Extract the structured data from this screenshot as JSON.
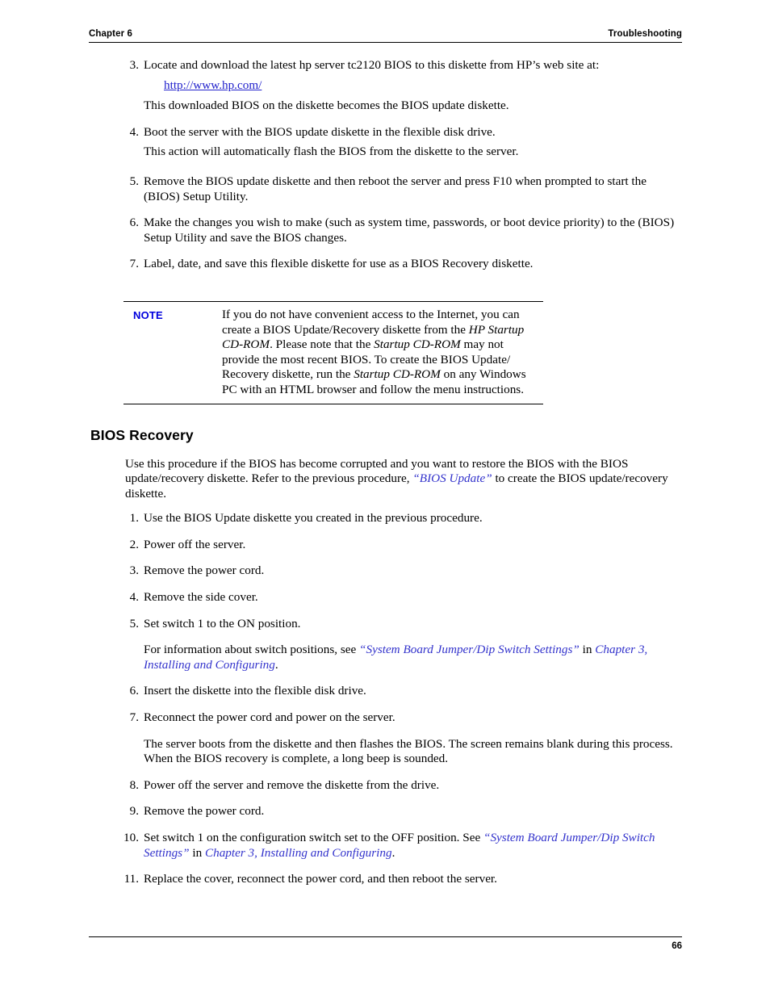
{
  "header": {
    "left": "Chapter 6",
    "right": "Troubleshooting"
  },
  "footer": {
    "page_number": "66"
  },
  "colors": {
    "link": "#2222cc",
    "xref": "#3333cc",
    "note_label": "#0000dd",
    "text": "#000000",
    "rule": "#000000"
  },
  "bios_update_continued": {
    "items": [
      {
        "num": "3.",
        "text": "Locate and download the latest hp server tc2120 BIOS to this diskette from HP’s web site at:"
      },
      {
        "num": "4.",
        "text": "Boot the server with the BIOS update diskette in the flexible disk drive."
      },
      {
        "num": "5.",
        "text": "Remove the BIOS update diskette and then reboot the server and press F10 when prompted to start the (BIOS) Setup Utility."
      },
      {
        "num": "6.",
        "text": "Make the changes you wish to make (such as system time, passwords, or boot device priority) to the (BIOS) Setup Utility and save the BIOS changes."
      },
      {
        "num": "7.",
        "text": "Label, date, and save this flexible diskette for use as a BIOS Recovery diskette."
      }
    ],
    "url": "http://www.hp.com/",
    "after_url_text": "This downloaded BIOS on the diskette becomes the BIOS update diskette.",
    "after_item4_text": "This action will automatically flash the BIOS from the diskette to the server."
  },
  "note": {
    "label": "NOTE",
    "line1": "If you do not have convenient access to the Internet, you can",
    "line2_pre": "create a BIOS Update/Recovery diskette from the ",
    "line2_italic": "HP Startup",
    "line3_italic": "CD-ROM",
    "line3_mid": ". Please note that the ",
    "line3_italic2": "Startup CD-ROM",
    "line3_post": " may not",
    "line4": "provide the most recent BIOS. To create the BIOS Update/",
    "line5_pre": "Recovery diskette, run the ",
    "line5_italic": "Startup CD-ROM",
    "line5_post": " on any Windows",
    "line6": "PC with an HTML browser and follow the menu instructions."
  },
  "bios_recovery": {
    "heading": "BIOS Recovery",
    "intro_pre": "Use this procedure if the BIOS has become corrupted and you want to restore the BIOS with the BIOS update/recovery diskette. Refer to the previous procedure, ",
    "intro_xref": "“BIOS Update”",
    "intro_post": " to create the BIOS update/recovery diskette.",
    "items": [
      {
        "num": "1.",
        "text": "Use the BIOS Update diskette you created in the previous procedure."
      },
      {
        "num": "2.",
        "text": "Power off the server."
      },
      {
        "num": "3.",
        "text": "Remove the power cord."
      },
      {
        "num": "4.",
        "text": "Remove the side cover."
      },
      {
        "num": "5.",
        "text": "Set switch 1 to the ON position."
      },
      {
        "num": "6.",
        "text": "Insert the diskette into the flexible disk drive."
      },
      {
        "num": "7.",
        "text": "Reconnect the power cord and power on the server."
      },
      {
        "num": "8.",
        "text": "Power off the server and remove the diskette from the drive."
      },
      {
        "num": "9.",
        "text": "Remove the power cord."
      },
      {
        "num": "10.",
        "text": "Set switch 1 on the configuration switch set to the OFF position. See "
      },
      {
        "num": "11.",
        "text": "Replace the cover, reconnect the power cord, and then reboot the server."
      }
    ],
    "switch_note_pre": "For information about switch positions, see ",
    "switch_note_xref1": "“System Board Jumper/Dip Switch Settings”",
    "switch_note_mid": " in ",
    "switch_note_xref2": "Chapter 3, Installing and Configuring",
    "switch_note_post": ".",
    "boot_note": "The server boots from the diskette and then flashes the BIOS. The screen remains blank during this process. When the BIOS recovery is complete, a long beep is sounded.",
    "item10_xref1": "“System Board Jumper/Dip Switch Settings”",
    "item10_mid": " in ",
    "item10_xref2": "Chapter 3, Installing and Configuring",
    "item10_post": "."
  }
}
